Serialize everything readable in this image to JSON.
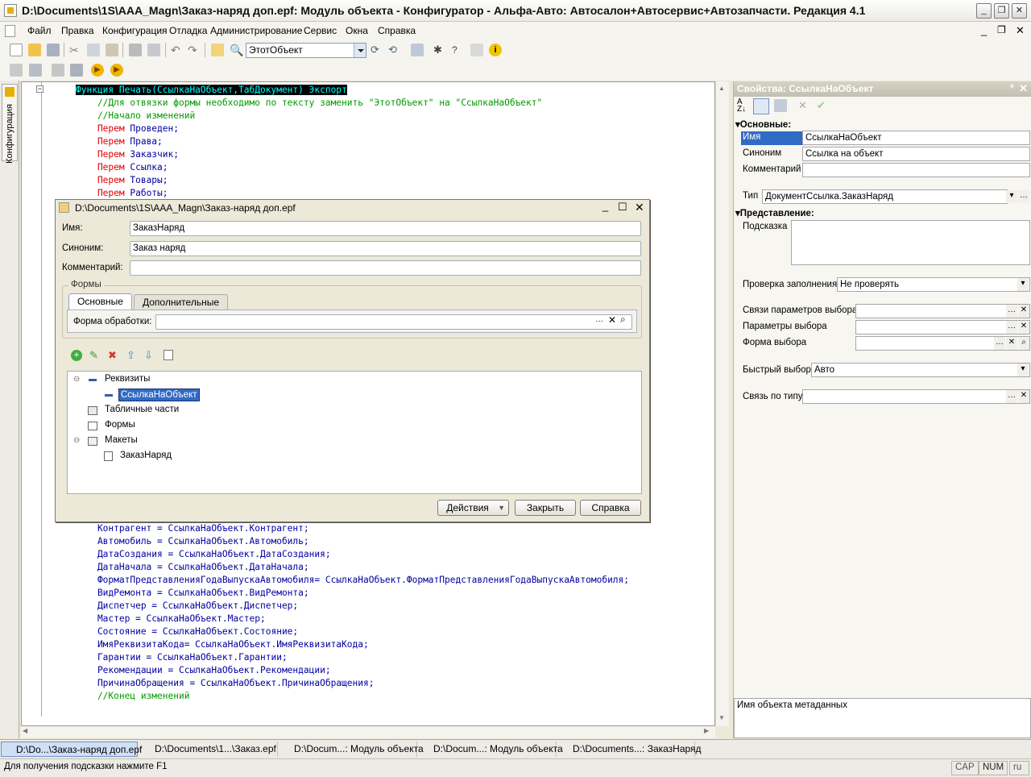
{
  "window": {
    "title": "D:\\Documents\\1S\\AAA_Magn\\Заказ-наряд доп.epf: Модуль объекта - Конфигуратор - Альфа-Авто: Автосалон+Автосервис+Автозапчасти. Редакция 4.1"
  },
  "menu": [
    "Файл",
    "Правка",
    "Конфигурация",
    "Отладка",
    "Администрирование",
    "Сервис",
    "Окна",
    "Справка"
  ],
  "toolbar": {
    "combo_value": "ЭтотОбъект"
  },
  "left_tab": "Конфигурация",
  "code": {
    "top": [
      {
        "t": "Функция Печать(СсылкаНаОбъект,ТабДокумент) Экспорт",
        "c": "hl"
      },
      {
        "t": "    //Для отвязки формы необходимо по тексту заменить \"ЭтотОбъект\" на \"СсылкаНаОбъект\"",
        "c": "cm"
      },
      {
        "t": "    //Начало изменений",
        "c": "cm"
      },
      {
        "k": "    Перем ",
        "t": "Проведен;"
      },
      {
        "k": "    Перем ",
        "t": "Права;"
      },
      {
        "k": "    Перем ",
        "t": "Заказчик;"
      },
      {
        "k": "    Перем ",
        "t": "Ссылка;"
      },
      {
        "k": "    Перем ",
        "t": "Товары;"
      },
      {
        "k": "    Перем ",
        "t": "Работы;"
      }
    ],
    "bottom": [
      "    Контрагент = СсылкаНаОбъект.Контрагент;",
      "    Автомобиль = СсылкаНаОбъект.Автомобиль;",
      "    ДатаСоздания = СсылкаНаОбъект.ДатаСоздания;",
      "    ДатаНачала = СсылкаНаОбъект.ДатаНачала;",
      "    ФорматПредставленияГодаВыпускаАвтомобиля= СсылкаНаОбъект.ФорматПредставленияГодаВыпускаАвтомобиля;",
      "    ВидРемонта = СсылкаНаОбъект.ВидРемонта;",
      "    Диспетчер = СсылкаНаОбъект.Диспетчер;",
      "    Мастер = СсылкаНаОбъект.Мастер;",
      "    Состояние = СсылкаНаОбъект.Состояние;",
      "    ИмяРеквизитаКода= СсылкаНаОбъект.ИмяРеквизитаКода;",
      "    Гарантии = СсылкаНаОбъект.Гарантии;",
      "    Рекомендации = СсылкаНаОбъект.Рекомендации;",
      "    ПричинаОбращения = СсылкаНаОбъект.ПричинаОбращения;"
    ],
    "end_comment": "    //Конец изменений"
  },
  "dialog": {
    "title": "D:\\Documents\\1S\\AAA_Magn\\Заказ-наряд доп.epf",
    "name_label": "Имя:",
    "name_value": "ЗаказНаряд",
    "synonym_label": "Синоним:",
    "synonym_value": "Заказ наряд",
    "comment_label": "Комментарий:",
    "comment_value": "",
    "forms_group": "Формы",
    "tabs": [
      "Основные",
      "Дополнительные"
    ],
    "form_label": "Форма обработки:",
    "tree": [
      "Реквизиты",
      "СсылкаНаОбъект",
      "Табличные части",
      "Формы",
      "Макеты",
      "ЗаказНаряд"
    ],
    "buttons": {
      "actions": "Действия",
      "close": "Закрыть",
      "help": "Справка"
    }
  },
  "props": {
    "title": "Свойства: СсылкаНаОбъект",
    "sec_main": "Основные:",
    "name_label": "Имя",
    "name_value": "СсылкаНаОбъект",
    "synonym_label": "Синоним",
    "synonym_value": "Ссылка на объект",
    "comment_label": "Комментарий",
    "type_label": "Тип",
    "type_value": "ДокументСсылка.ЗаказНаряд",
    "sec_view": "Представление:",
    "hint_label": "Подсказка",
    "fillcheck_label": "Проверка заполнения",
    "fillcheck_value": "Не проверять",
    "links_label": "Связи параметров выбора",
    "params_label": "Параметры выбора",
    "form_label": "Форма выбора",
    "quick_label": "Быстрый выбор",
    "quick_value": "Авто",
    "typelink_label": "Связь по типу",
    "description": "Имя объекта метаданных"
  },
  "taskbar": [
    "D:\\Do...\\Заказ-наряд доп.epf",
    "D:\\Documents\\1...\\Заказ.epf",
    "D:\\Docum...: Модуль объекта",
    "D:\\Docum...: Модуль объекта",
    "D:\\Documents...: ЗаказНаряд"
  ],
  "status": {
    "hint": "Для получения подсказки нажмите F1",
    "cap": "CAP",
    "num": "NUM",
    "lang": "ru"
  }
}
